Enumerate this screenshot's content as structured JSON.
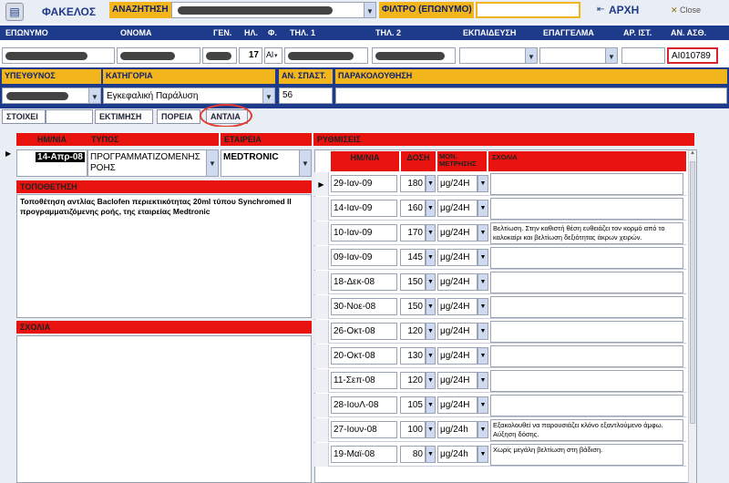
{
  "toolbar": {
    "folder_label": "ΦΑΚΕΛΟΣ",
    "search_label": "ΑΝΑΖΗΤΗΣΗ",
    "filter_label": "ΦΙΛΤΡΟ (ΕΠΩΝΥΜΟ)",
    "home_label": "ΑΡΧΗ",
    "close_label": "Close"
  },
  "patient_headers": {
    "surname": "ΕΠΩΝΥΜΟ",
    "name": "ΟΝΟΜΑ",
    "birth": "ΓΕΝ.",
    "age": "ΗΛ.",
    "sex": "Φ.",
    "phone1": "ΤΗΛ. 1",
    "phone2": "ΤΗΛ. 2",
    "education": "ΕΚΠΑΙΔΕΥΣΗ",
    "profession": "ΕΠΑΓΓΕΛΜΑ",
    "id_no": "ΑΡ. ΙΣΤ.",
    "ins_no": "ΑΝ. ΑΣΘ."
  },
  "patient": {
    "age": "17",
    "sex": "Al",
    "ins_no": "AI010789"
  },
  "case_headers": {
    "responsible": "ΥΠΕΥΘΥΝΟΣ",
    "category": "ΚΑΤΗΓΟΡΙΑ",
    "spasticity": "ΑΝ. ΣΠΑΣΤ.",
    "followup": "ΠΑΡΑΚΟΛΟΥΘΗΣΗ"
  },
  "case": {
    "category": "Εγκεφαλική Παράλυση",
    "spasticity": "56"
  },
  "tabs": [
    "ΣΤΟΙΧΕΙ",
    "ΕΚΤΙΜΗΣΗ",
    "ΠΟΡΕΙΑ",
    "ΑΝΤΛΙΑ"
  ],
  "pump_headers": {
    "date": "ΗΜ/ΝΙΑ",
    "type": "ΤΥΠΟΣ",
    "company": "ΕΤΑΙΡΕΙΑ"
  },
  "pump": {
    "date": "14-Απρ-08",
    "type": "ΠΡΟΓΡΑΜΜΑΤΙΖΟΜΕΝΗΣ ΡΟΗΣ",
    "company": "MEDTRONIC"
  },
  "placement": {
    "label": "ΤΟΠΟΘΕΤΗΣΗ",
    "text": "Τοποθέτηση αντλίας Baclofen περιεκτικότητας 20ml τύπου Synchromed II προγραμματιζόμενης ροής, της εταιρείας Medtronic"
  },
  "comments": {
    "label": "ΣΧΟΛΙΑ"
  },
  "settings": {
    "label": "ΡΥΘΜΙΣΕΙΣ",
    "headers": {
      "date": "ΗΜ/ΝΙΑ",
      "dose": "ΔΟΣΗ",
      "unit": "ΜΟΝ. ΜΕΤΡΗΣΗΣ",
      "notes": "ΣΧΟΛΙΑ"
    },
    "rows": [
      {
        "date": "29-Ιαν-09",
        "dose": "180",
        "unit": "μg/24H",
        "note": ""
      },
      {
        "date": "14-Ιαν-09",
        "dose": "160",
        "unit": "μg/24H",
        "note": ""
      },
      {
        "date": "10-Ιαν-09",
        "dose": "170",
        "unit": "μg/24H",
        "note": "Βελτίωση. Στην καθιστή θέση ευθειάζει τον κορμό από το καλοκαίρι και βελτίωση δεξιότητας άκρων χειρών."
      },
      {
        "date": "09-Ιαν-09",
        "dose": "145",
        "unit": "μg/24H",
        "note": ""
      },
      {
        "date": "18-Δεκ-08",
        "dose": "150",
        "unit": "μg/24H",
        "note": ""
      },
      {
        "date": "30-Νοε-08",
        "dose": "150",
        "unit": "μg/24H",
        "note": ""
      },
      {
        "date": "26-Οκτ-08",
        "dose": "120",
        "unit": "μg/24H",
        "note": ""
      },
      {
        "date": "20-Οκτ-08",
        "dose": "130",
        "unit": "μg/24H",
        "note": ""
      },
      {
        "date": "11-Σεπ-08",
        "dose": "120",
        "unit": "μg/24H",
        "note": ""
      },
      {
        "date": "28-ΙουΛ-08",
        "dose": "105",
        "unit": "μg/24H",
        "note": ""
      },
      {
        "date": "27-Ιουν-08",
        "dose": "100",
        "unit": "μg/24h",
        "note": "Εξακολουθεί να παρουσιάζει κλόνο εξαντλούμενο άμφω. Αύξηση δόσης."
      },
      {
        "date": "19-Μαϊ-08",
        "dose": "80",
        "unit": "μg/24h",
        "note": "Χωρίς μεγάλη βελτίωση στη βάδιση."
      }
    ]
  }
}
